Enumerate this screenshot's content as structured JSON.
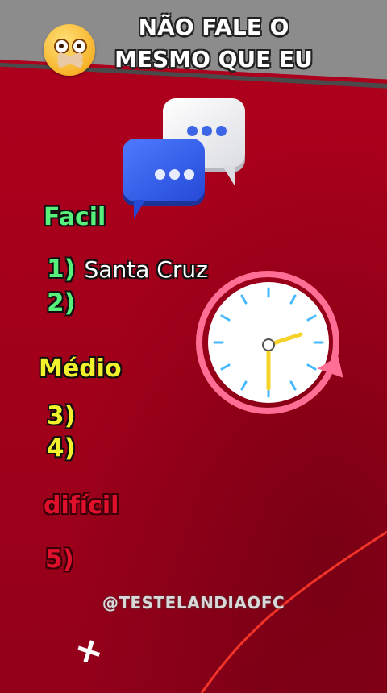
{
  "header": {
    "title_line1": "NÃO FALE O",
    "title_line2": "MESMO QUE EU"
  },
  "sections": [
    {
      "heading": "Facil",
      "items": [
        {
          "num": "1)",
          "text": "Santa Cruz"
        },
        {
          "num": "2)",
          "text": ""
        }
      ]
    },
    {
      "heading": "Médio",
      "items": [
        {
          "num": "3)",
          "text": ""
        },
        {
          "num": "4)",
          "text": ""
        }
      ]
    },
    {
      "heading": "difícil",
      "items": [
        {
          "num": "5)",
          "text": ""
        }
      ]
    }
  ],
  "watermark": "@TESTELANDIAOFC",
  "icons": {
    "emoji": "shushing-face-emoji-icon",
    "chat": "chat-bubbles-icon",
    "clock": "clock-icon",
    "plus": "plus-icon"
  },
  "colors": {
    "background": "#a8001c",
    "easy": "#56f07a",
    "medium": "#f2f22c",
    "hard": "#e0102c",
    "clock_ring": "#ff6f95",
    "clock_hand": "#f5d32a"
  }
}
